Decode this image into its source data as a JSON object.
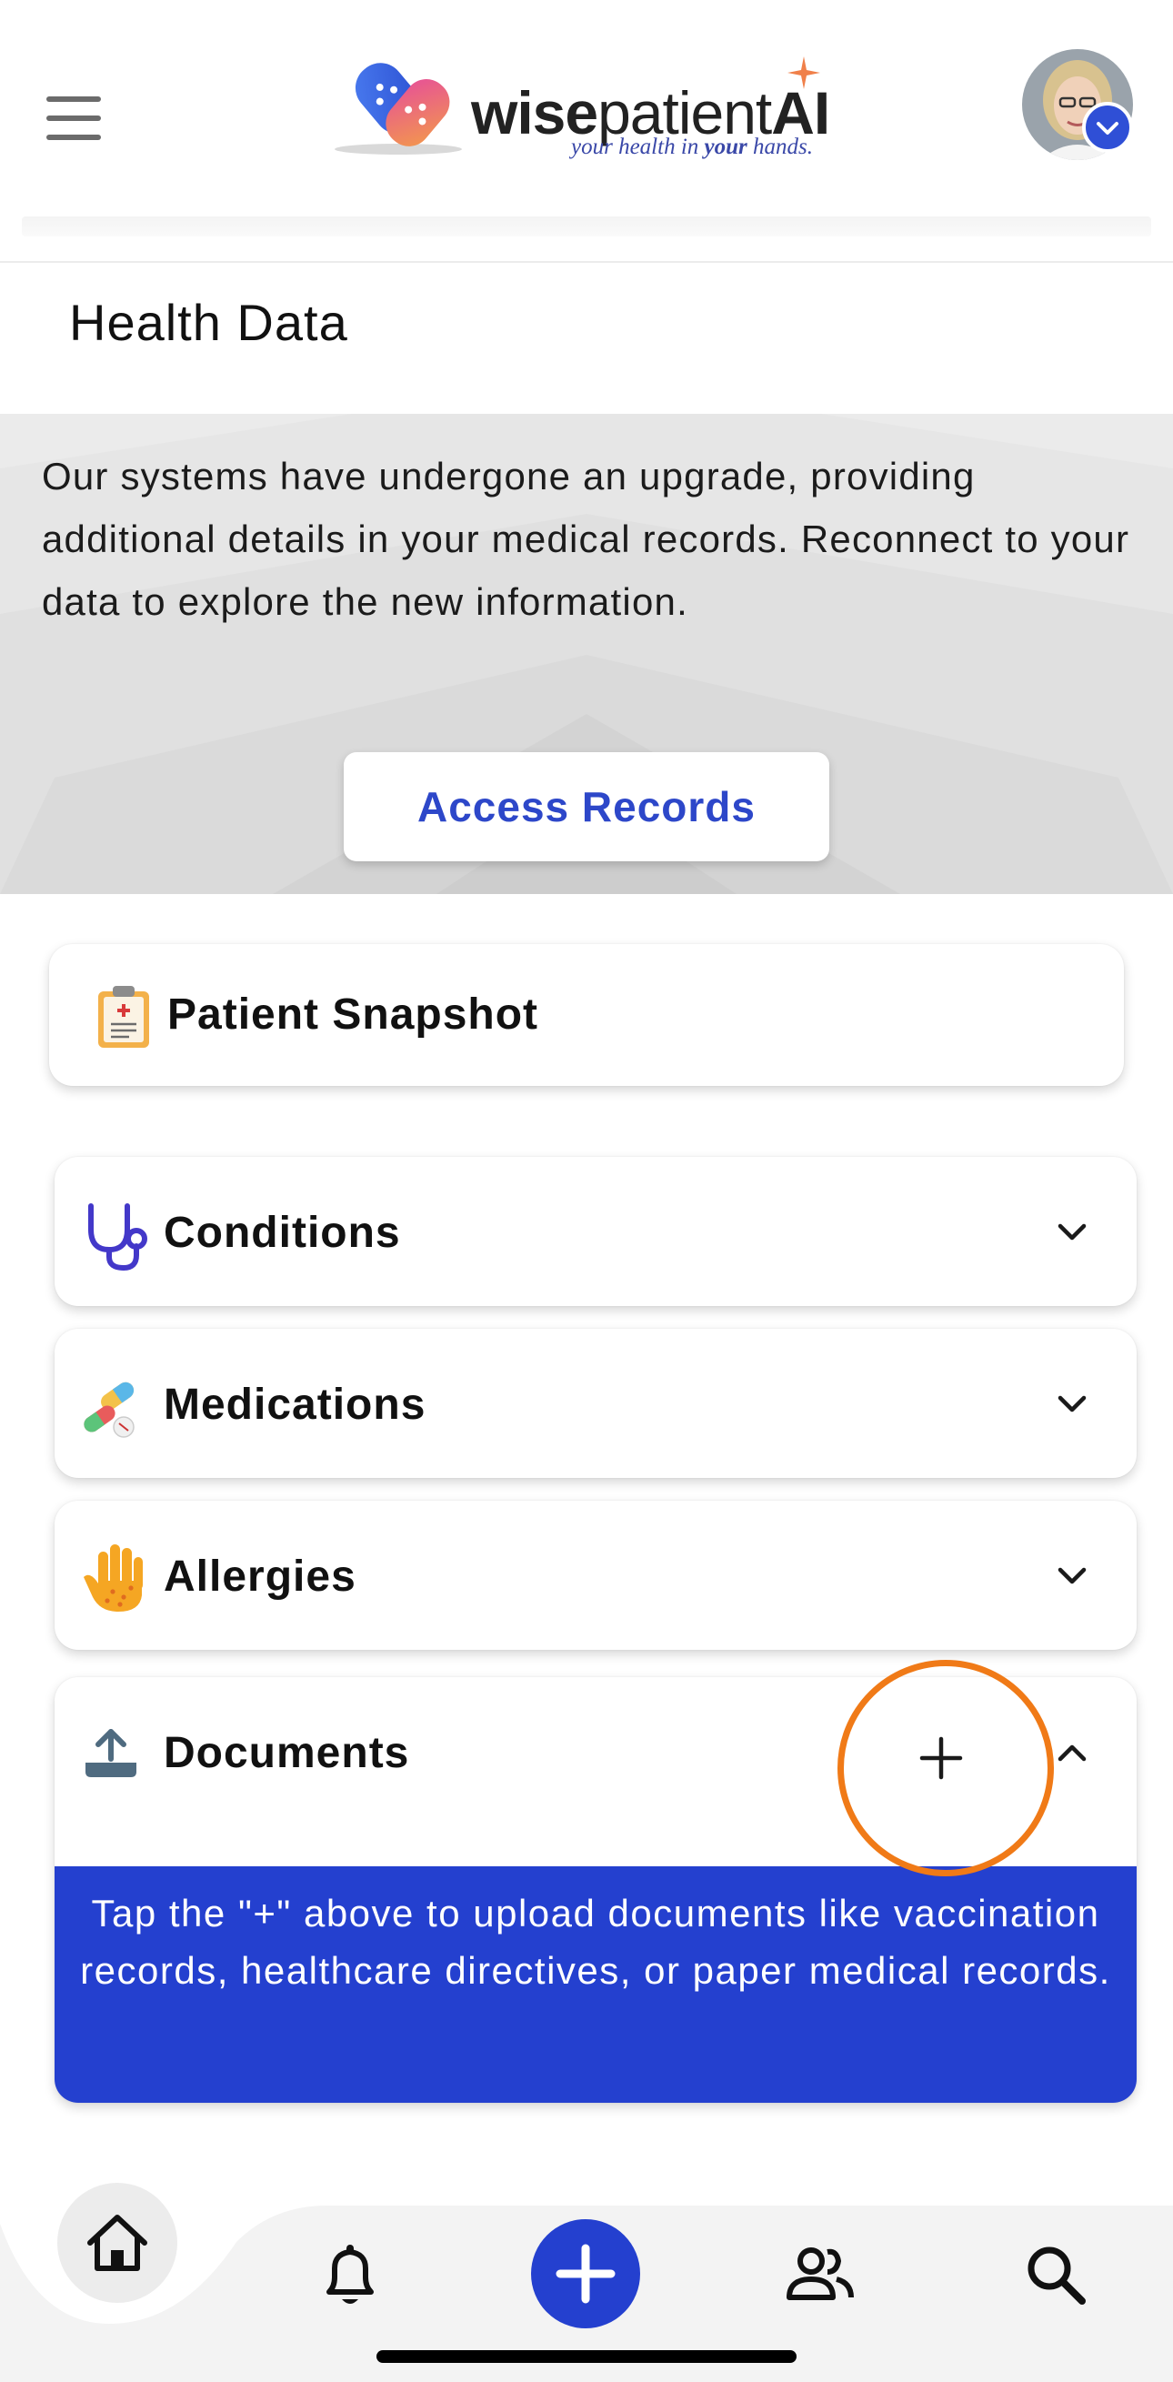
{
  "header": {
    "logo_word_bold": "wise",
    "logo_word_light": "patient",
    "logo_word_ai": "AI",
    "logo_tag_pre": "your health in ",
    "logo_tag_bold": "your",
    "logo_tag_post": " hands."
  },
  "page": {
    "title": "Health Data"
  },
  "banner": {
    "message": "Our systems have undergone an upgrade, providing additional details in your medical records. Reconnect to your data to explore the new information.",
    "button_label": "Access Records"
  },
  "cards": {
    "snapshot_label": "Patient Snapshot",
    "conditions_label": "Conditions",
    "medications_label": "Medications",
    "allergies_label": "Allergies",
    "documents_label": "Documents",
    "documents_info": "Tap the \"+\" above to upload documents like vaccination records, healthcare directives, or paper medical records."
  },
  "colors": {
    "accent_blue": "#2440cf",
    "highlight_orange": "#f07a17",
    "banner_bg": "#ebebeb"
  },
  "icons": {
    "menu": "hamburger-icon",
    "snapshot": "clipboard-icon",
    "conditions": "stethoscope-icon",
    "medications": "pills-icon",
    "allergies": "hand-icon",
    "documents": "upload-icon",
    "home": "home-icon",
    "notifications": "bell-icon",
    "add": "plus-icon",
    "people": "people-icon",
    "search": "search-icon"
  }
}
